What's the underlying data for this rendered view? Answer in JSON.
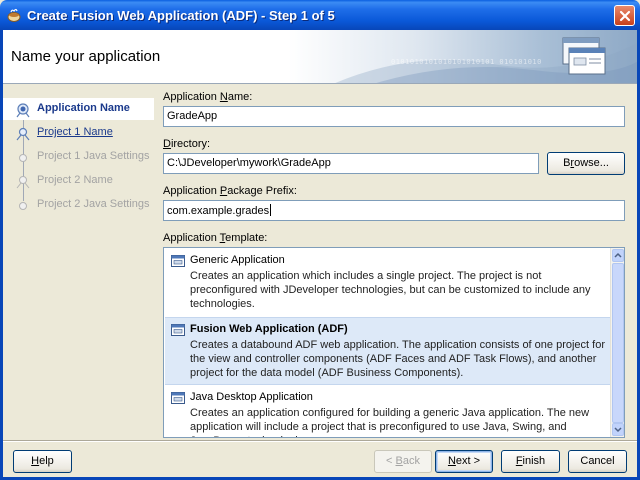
{
  "window": {
    "title": "Create Fusion Web Application (ADF) - Step 1 of 5"
  },
  "header": {
    "title": "Name your application",
    "banner_bits": "0101010101010101010101 010101010"
  },
  "nav": {
    "items": [
      {
        "label": "Application Name",
        "state": "selected"
      },
      {
        "label": "Project 1 Name",
        "state": "link"
      },
      {
        "label": "Project 1 Java Settings",
        "state": "disabled"
      },
      {
        "label": "Project 2 Name",
        "state": "disabled"
      },
      {
        "label": "Project 2 Java Settings",
        "state": "disabled"
      }
    ]
  },
  "form": {
    "app_name_label_pre": "Application ",
    "app_name_label_u": "N",
    "app_name_label_post": "ame:",
    "app_name_value": "GradeApp",
    "directory_label_u": "D",
    "directory_label_post": "irectory:",
    "directory_value": "C:\\JDeveloper\\mywork\\GradeApp",
    "browse_label_pre": "B",
    "browse_label_u": "r",
    "browse_label_post": "owse...",
    "package_label_pre": "Application ",
    "package_label_u": "P",
    "package_label_post": "ackage Prefix:",
    "package_value": "com.example.grades",
    "template_label_pre": "Application ",
    "template_label_u": "T",
    "template_label_post": "emplate:"
  },
  "templates": [
    {
      "name": "Generic Application",
      "description": "Creates an application which includes a single project. The project is not preconfigured with JDeveloper technologies, but can be customized to include any technologies."
    },
    {
      "name": "Fusion Web Application (ADF)",
      "description": "Creates a databound ADF web application. The application consists of one project for the view and controller components (ADF Faces and ADF Task Flows), and another project for the data model (ADF Business Components)."
    },
    {
      "name": "Java Desktop Application",
      "description": "Creates an application configured for building a generic Java application. The new application will include a project that is preconfigured to use Java, Swing, and JavaBeans technologies."
    }
  ],
  "buttons": {
    "help_u": "H",
    "help_post": "elp",
    "back_pre": "< ",
    "back_u": "B",
    "back_post": "ack",
    "next_u": "N",
    "next_post": "ext >",
    "finish_u": "F",
    "finish_post": "inish",
    "cancel": "Cancel"
  },
  "colors": {
    "titlebar": "#0a58d8",
    "link": "#1b3a8c",
    "selection": "#dde9f8"
  }
}
